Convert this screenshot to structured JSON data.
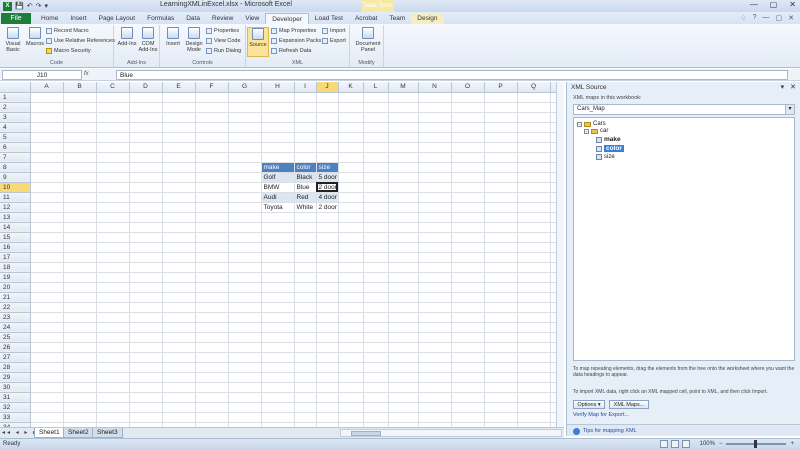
{
  "window": {
    "title": "LearningXMLinExcel.xlsx - Microsoft Excel",
    "file_icon": "X",
    "context_header": "Table Tools",
    "controls": [
      "—",
      "▢",
      "✕"
    ]
  },
  "qat": {
    "save": "💾",
    "undo": "↶",
    "redo": "↷",
    "dropdown": "▾"
  },
  "tabs": [
    "Home",
    "Insert",
    "Page Layout",
    "Formulas",
    "Data",
    "Review",
    "View",
    "Developer",
    "Load Test",
    "Acrobat",
    "Team",
    "Design"
  ],
  "file_tab": "File",
  "active_tab": "Developer",
  "tabrow_right": [
    "♢",
    "?",
    "—",
    "▢",
    "✕"
  ],
  "ribbon": {
    "groups": {
      "code": "Code",
      "addins": "Add-Ins",
      "controls": "Controls",
      "xml": "XML",
      "modify": "Modify"
    },
    "code": {
      "visual_basic": "Visual Basic",
      "macros": "Macros",
      "record_macro": "Record Macro",
      "relative_refs": "Use Relative References",
      "macro_security": "Macro Security"
    },
    "addins": {
      "addins": "Add-Ins",
      "com_addins": "COM Add-Ins"
    },
    "controls": {
      "insert": "Insert",
      "design_mode": "Design Mode",
      "properties": "Properties",
      "view_code": "View Code",
      "run_dialog": "Run Dialog"
    },
    "xml": {
      "source": "Source",
      "map_properties": "Map Properties",
      "expansion_packs": "Expansion Packs",
      "refresh_data": "Refresh Data",
      "import": "Import",
      "export": "Export"
    },
    "modify": {
      "document_panel": "Document Panel"
    }
  },
  "formula_bar": {
    "cell": "J10",
    "fx": "fx",
    "value": "Blue"
  },
  "grid": {
    "columns": [
      "A",
      "B",
      "C",
      "D",
      "E",
      "F",
      "G",
      "H",
      "I",
      "J",
      "K",
      "L",
      "M",
      "N",
      "O",
      "P",
      "Q",
      "R"
    ],
    "rows": [
      "1",
      "2",
      "3",
      "4",
      "5",
      "6",
      "7",
      "8",
      "9",
      "10",
      "11",
      "12",
      "13",
      "14",
      "15",
      "16",
      "17",
      "18",
      "19",
      "20",
      "21",
      "22",
      "23",
      "24",
      "25",
      "26",
      "27",
      "28",
      "29",
      "30",
      "31",
      "32",
      "33",
      "34"
    ],
    "selected_column": "J",
    "selected_row": "10"
  },
  "table": {
    "headers": [
      "make",
      "color",
      "size"
    ],
    "rows": [
      [
        "Golf",
        "Black",
        "5 door"
      ],
      [
        "BMW",
        "Blue",
        "2 door"
      ],
      [
        "Audi",
        "Red",
        "4 door"
      ],
      [
        "Toyota",
        "White",
        "2 door"
      ]
    ]
  },
  "xml_pane": {
    "title": "XML Source",
    "ctrl_dropdown": "▾",
    "ctrl_close": "✕",
    "maps_label": "XML maps in this workbook:",
    "selected_map": "Cars_Map",
    "tree": {
      "root": "Cars",
      "child": "car",
      "fields": [
        "make",
        "color",
        "size"
      ],
      "highlighted": "color"
    },
    "help1": "To map repeating elements, drag the elements from the tree onto the worksheet where you want the data headings to appear.",
    "help2": "To import XML data, right click an XML mapped cell, point to XML, and then click Import.",
    "options_btn": "Options ▾",
    "xml_maps_btn": "XML Maps...",
    "verify_link": "Verify Map for Export...",
    "tips_link": "Tips for mapping XML"
  },
  "sheets": [
    "Sheet1",
    "Sheet2",
    "Sheet3"
  ],
  "active_sheet": "Sheet1",
  "nav_arrows": "◂◂ ◂ ▸ ▸▸",
  "status": {
    "mode": "Ready",
    "zoom": "100%",
    "zoom_minus": "−",
    "zoom_plus": "+"
  }
}
